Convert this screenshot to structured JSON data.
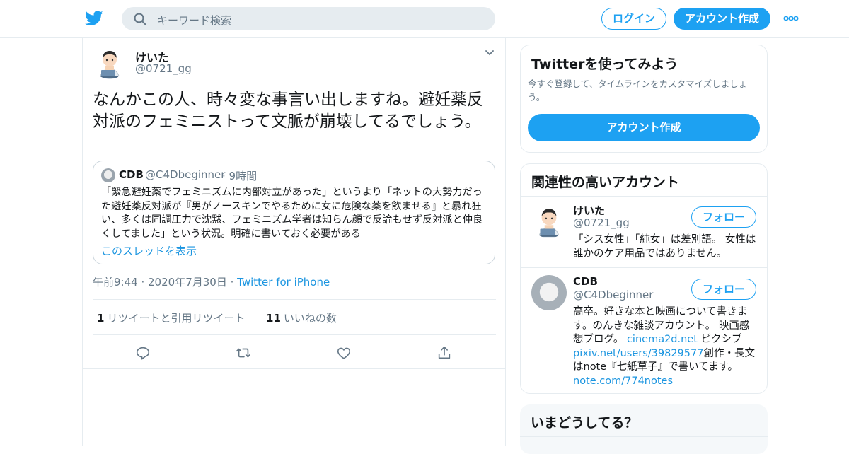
{
  "header": {
    "search_placeholder": "キーワード検索",
    "login_label": "ログイン",
    "signup_label": "アカウント作成"
  },
  "tweet": {
    "name": "けいた",
    "handle": "@0721_gg",
    "text": "なんかこの人、時々変な事言い出しますね。避妊薬反対派のフェミニストって文脈が崩壊してるでしょう。",
    "quote": {
      "name": "CDB",
      "handle": "@C4Dbeginner",
      "time": "9時間",
      "text": "「緊急避妊薬でフェミニズムに内部対立があった」というより「ネットの大勢力だった避妊薬反対派が『男がノースキンでやるために女に危険な薬を飲ませる』と暴れ狂い、多くは同調圧力で沈黙、フェミニズム学者は知らん顔で反論もせず反対派と仲良くしてました」という状況。明確に書いておく必要がある",
      "show_thread": "このスレッドを表示"
    },
    "time": "午前9:44",
    "date": "2020年7月30日",
    "source": "Twitter for iPhone",
    "retweets_count": "1",
    "retweets_label": "リツイートと引用リツイート",
    "likes_count": "11",
    "likes_label": "いいねの数"
  },
  "sidebar": {
    "try_title": "Twitterを使ってみよう",
    "try_desc": "今すぐ登録して、タイムラインをカスタマイズしましょう。",
    "try_button": "アカウント作成",
    "related_title": "関連性の高いアカウント",
    "accounts": [
      {
        "name": "けいた",
        "handle": "@0721_gg",
        "follow_label": "フォロー",
        "bio": "「シス女性」「純女」は差別語。 女性は誰かのケア用品ではありません。"
      },
      {
        "name": "CDB",
        "handle": "@C4Dbeginner",
        "follow_label": "フォロー",
        "bio_a": "高卒。好きな本と映画について書きます。のんきな雑談アカウント。 映画感想ブログ。",
        "bio_link1": "cinema2d.net",
        "bio_b": " ピクシブ",
        "bio_link2": "pixiv.net/users/39829577",
        "bio_c": "創作・長文はnote『七紙草子』で書いてます。",
        "bio_link3": "note.com/774notes"
      }
    ],
    "trends_title": "いまどうしてる？"
  },
  "colors": {
    "brand": "#1da1f2",
    "link": "#1b95e0",
    "secondary_text": "#657786",
    "border": "#e6ecf0"
  },
  "icons": [
    "twitter-bird-icon",
    "search-icon",
    "more-dots-icon",
    "chevron-down-icon",
    "reply-icon",
    "retweet-icon",
    "like-icon",
    "share-icon"
  ]
}
